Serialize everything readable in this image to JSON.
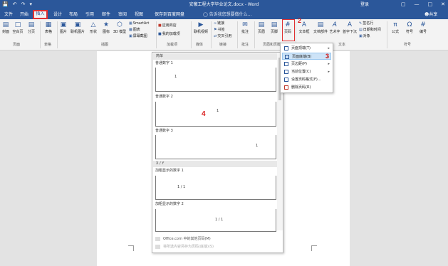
{
  "window": {
    "quick_access": [
      "💾",
      "↶",
      "↷",
      "▾"
    ],
    "title": "安徽工程大学毕业论文.docx - Word",
    "login": "登录",
    "controls": [
      "▢",
      "—",
      "□",
      "✕"
    ]
  },
  "tabs": [
    "文件",
    "开始",
    "插入",
    "设计",
    "布局",
    "引用",
    "邮件",
    "审阅",
    "视图",
    "保存到百度网盘"
  ],
  "tell_me": "告诉我您想要做什么...",
  "share": "共享",
  "ribbon": {
    "buttons": {
      "cover": "封面",
      "blank": "空白页",
      "break": "分页",
      "table": "表格",
      "picture": "图片",
      "online_picture": "联机图片",
      "shapes": "形状",
      "icons": "图标",
      "model": "3D 模型",
      "smartart": "SmartArt",
      "chart": "图表",
      "screenshot": "屏幕截图",
      "store": "应用商店",
      "my_addins": "我的加载项",
      "online_video": "联机视频",
      "link": "链接",
      "bookmark": "书签",
      "crossref": "交叉引用",
      "comment": "批注",
      "header": "页眉",
      "footer": "页脚",
      "page_number": "页码",
      "textbox": "文本框",
      "doc_parts": "文档部件",
      "wordart": "艺术字",
      "dropcap": "首字下沉",
      "signature": "签名行",
      "datetime": "日期和时间",
      "object": "对象",
      "formula": "公式",
      "symbol": "符号",
      "numbering": "编号"
    },
    "groups": [
      "页面",
      "表格",
      "插图",
      "加载项",
      "媒体",
      "链接",
      "批注",
      "页眉和页脚",
      "文本",
      "符号"
    ]
  },
  "submenu": {
    "items": [
      {
        "label": "页面顶端(T)",
        "arrow": "▸"
      },
      {
        "label": "页面底端(B)",
        "arrow": "▸"
      },
      {
        "label": "页边距(P)",
        "arrow": "▸"
      },
      {
        "label": "当前位置(C)",
        "arrow": "▸"
      },
      {
        "label": "设置页码格式(F)...",
        "arrow": ""
      },
      {
        "label": "删除页码(R)",
        "arrow": ""
      }
    ]
  },
  "gallery": {
    "header_simple": "简单",
    "items": [
      {
        "label": "普通数字 1",
        "preview": "1"
      },
      {
        "label": "普通数字 2",
        "preview": "1"
      },
      {
        "label": "普通数字 3",
        "preview": "1"
      }
    ],
    "header_xy": "X / Y",
    "xy_items": [
      {
        "label": "加粗显示的数字 1",
        "preview": "1 / 1"
      },
      {
        "label": "加粗显示的数字 2",
        "preview": "1 / 1"
      }
    ],
    "footer_more": "Office.com 中的其他页码(M)",
    "footer_save": "将所选内容另存为页码(底端)(S)"
  },
  "annotations": [
    "2",
    "3",
    "4"
  ]
}
